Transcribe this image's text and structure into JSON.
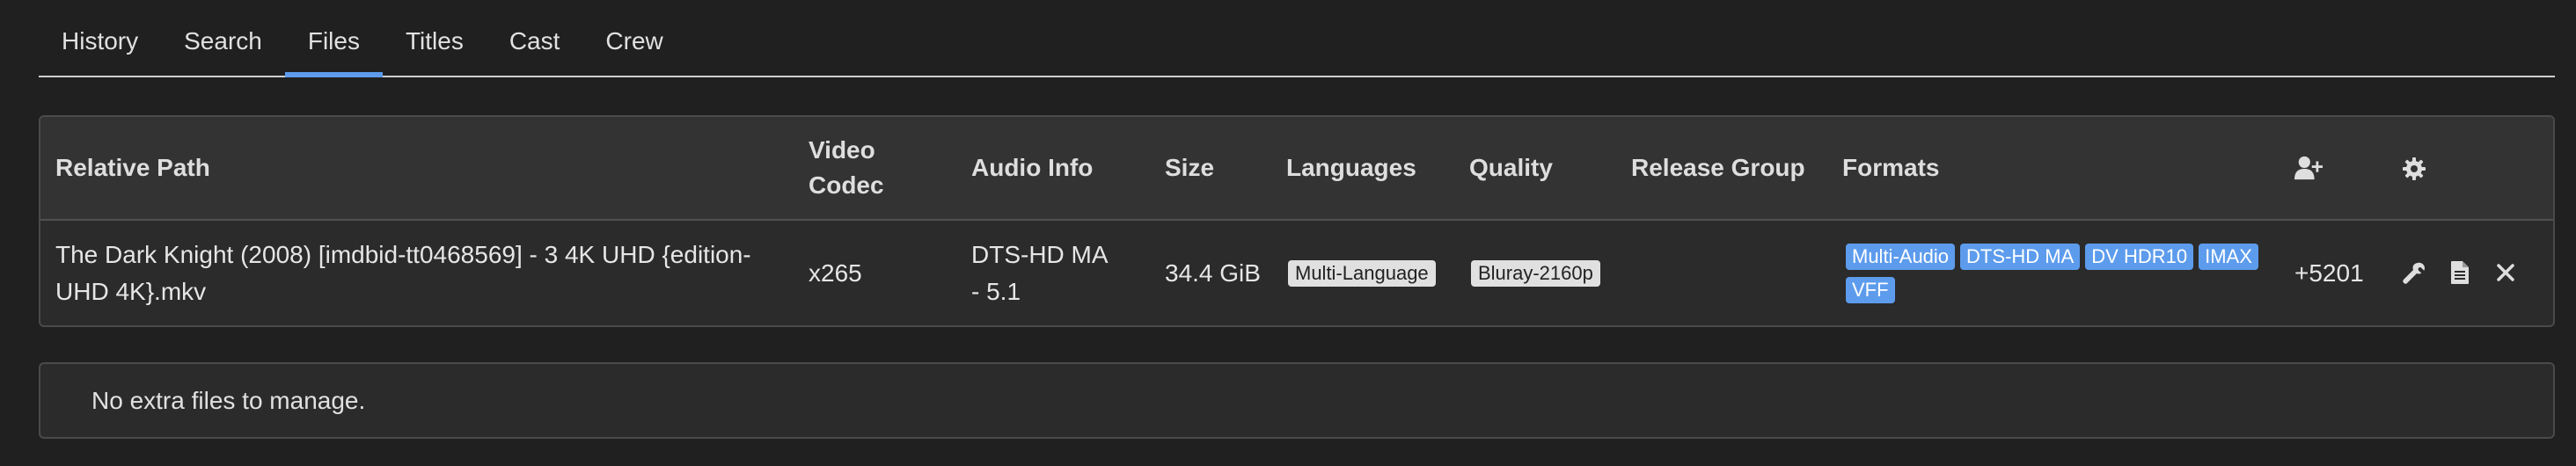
{
  "tabs": [
    {
      "label": "History",
      "active": false
    },
    {
      "label": "Search",
      "active": false
    },
    {
      "label": "Files",
      "active": true
    },
    {
      "label": "Titles",
      "active": false
    },
    {
      "label": "Cast",
      "active": false
    },
    {
      "label": "Crew",
      "active": false
    }
  ],
  "files_table": {
    "headers": {
      "relative_path": "Relative Path",
      "video_codec_line1": "Video",
      "video_codec_line2": "Codec",
      "audio_info": "Audio Info",
      "size": "Size",
      "languages": "Languages",
      "quality": "Quality",
      "release_group": "Release Group",
      "formats": "Formats",
      "custom_format_score_icon": "user-plus-icon",
      "settings_icon": "gear-icon"
    },
    "rows": [
      {
        "relative_path": "The Dark Knight (2008) [imdbid-tt0468569] - 3 4K UHD {edition-UHD 4K}.mkv",
        "video_codec": "x265",
        "audio_info": "DTS-HD MA - 5.1",
        "size": "34.4 GiB",
        "languages": "Multi-Language",
        "quality": "Bluray-2160p",
        "release_group": "",
        "formats": [
          "Multi-Audio",
          "DTS-HD MA",
          "DV HDR10",
          "IMAX",
          "VFF"
        ],
        "custom_format_score": "+5201",
        "actions": [
          "wrench-icon",
          "file-icon",
          "close-icon"
        ]
      }
    ]
  },
  "extra_files": {
    "message": "No extra files to manage."
  },
  "colors": {
    "background": "#202020",
    "panel": "#2b2b2b",
    "header": "#333333",
    "accent": "#5d9cec",
    "badge_light": "#e0e0e0"
  }
}
